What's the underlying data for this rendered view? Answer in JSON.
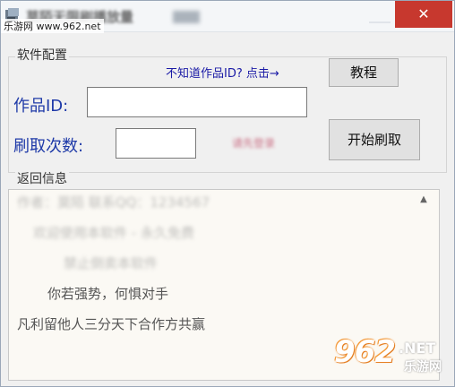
{
  "window": {
    "title": "莫陌无限刷播放量",
    "close_glyph": "✕"
  },
  "watermark": {
    "top_left": "乐游网 www.962.net",
    "logo_main": "962",
    "logo_net": ".NET",
    "logo_sub": "乐游网"
  },
  "config": {
    "group_label": "软件配置",
    "help_text": "不知道作品ID? 点击→",
    "tutorial_button": "教程",
    "work_id_label": "作品ID:",
    "work_id_value": "",
    "count_label": "刷取次数:",
    "count_value": "",
    "side_note": "请先登录",
    "start_button": "开始刷取"
  },
  "log": {
    "group_label": "返回信息",
    "lines": [
      "作者：莫陌  联系QQ：1234567",
      "欢迎使用本软件 - 永久免费",
      "禁止倒卖本软件",
      "你若强势，何惧对手",
      "凡利留他人三分天下合作方共赢"
    ]
  },
  "colors": {
    "close_button": "#c7382e",
    "label_blue": "#1f3aa8",
    "link_blue": "#1a1aa6",
    "watermark_orange": "#f08a2a"
  }
}
